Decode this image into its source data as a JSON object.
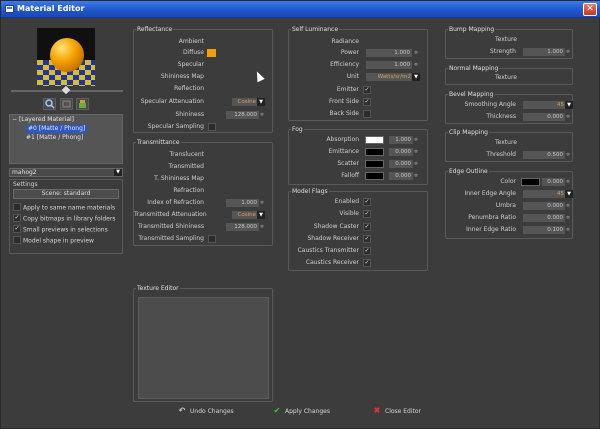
{
  "window": {
    "title": "Material Editor",
    "close_label": "✕"
  },
  "layer_tree": {
    "root": "[Layered Material]",
    "items": [
      "#0 [Matte / Phong]",
      "#1 [Matte / Phong]"
    ]
  },
  "material_select": "mahog2",
  "settings": {
    "title": "Settings",
    "scene_button": "Scene: standard",
    "options": [
      {
        "label": "Apply to same name materials",
        "checked": false
      },
      {
        "label": "Copy bitmaps in library folders",
        "checked": true
      },
      {
        "label": "Small previews in selections",
        "checked": true
      },
      {
        "label": "Model shape in preview",
        "checked": false
      }
    ]
  },
  "reflectance": {
    "title": "Reflectance",
    "ambient": "Ambient",
    "diffuse": "Diffuse",
    "diffuse_color": "#f0a000",
    "specular": "Specular",
    "shininess_map": "Shininess Map",
    "reflection": "Reflection",
    "specular_attenuation": "Specular Attenuation",
    "specular_attenuation_value": "Cosine",
    "shininess": "Shininess",
    "shininess_value": "128.000",
    "specular_sampling": "Specular Sampling"
  },
  "transmittance": {
    "title": "Transmittance",
    "translucent": "Translucent",
    "transmitted": "Transmitted",
    "t_shininess_map": "T. Shininess Map",
    "refraction": "Refraction",
    "ior": "Index of Refraction",
    "ior_value": "1.000",
    "attenuation": "Transmitted Attenuation",
    "attenuation_value": "Cosine",
    "shininess": "Transmitted Shininess",
    "shininess_value": "128.000",
    "sampling": "Transmitted Sampling"
  },
  "texture_editor": {
    "title": "Texture Editor"
  },
  "self_luminance": {
    "title": "Self Luminance",
    "radiance": "Radiance",
    "power": "Power",
    "power_value": "1.000",
    "efficiency": "Efficiency",
    "efficiency_value": "1.000",
    "unit": "Unit",
    "unit_value": "Watts/sr/m2",
    "emitter": "Emitter",
    "front_side": "Front Side",
    "back_side": "Back Side"
  },
  "fog": {
    "title": "Fog",
    "absorption": "Absorption",
    "absorption_value": "1.000",
    "emittance": "Emittance",
    "emittance_value": "0.000",
    "scatter": "Scatter",
    "scatter_value": "0.000",
    "falloff": "Falloff",
    "falloff_value": "0.000"
  },
  "model_flags": {
    "title": "Model Flags",
    "items": [
      "Enabled",
      "Visible",
      "Shadow Caster",
      "Shadow Receiver",
      "Caustics Transmitter",
      "Caustics Receiver"
    ]
  },
  "bump_mapping": {
    "title": "Bump Mapping",
    "texture": "Texture",
    "strength": "Strength",
    "strength_value": "1.000"
  },
  "normal_mapping": {
    "title": "Normal Mapping",
    "texture": "Texture"
  },
  "bevel_mapping": {
    "title": "Bevel Mapping",
    "smoothing_angle": "Smoothing Angle",
    "smoothing_value": "45",
    "thickness": "Thickness",
    "thickness_value": "0.000"
  },
  "clip_mapping": {
    "title": "Clip Mapping",
    "texture": "Texture",
    "threshold": "Threshold",
    "threshold_value": "0.500"
  },
  "edge_outline": {
    "title": "Edge Outline",
    "color": "Color",
    "color_value": "0.000",
    "inner_edge_angle": "Inner Edge Angle",
    "inner_edge_angle_value": "45",
    "umbra": "Umbra",
    "umbra_value": "0.000",
    "penumbra_ratio": "Penumbra Ratio",
    "penumbra_value": "0.000",
    "inner_edge_ratio": "Inner Edge Ratio",
    "inner_edge_ratio_value": "0.100"
  },
  "footer": {
    "undo": "Undo Changes",
    "apply": "Apply Changes",
    "close": "Close Editor"
  }
}
